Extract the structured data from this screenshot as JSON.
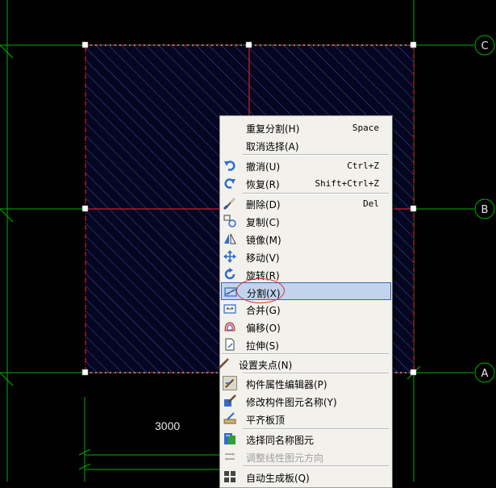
{
  "grid_labels": {
    "axis_a": "A",
    "axis_b": "B",
    "axis_c": "C"
  },
  "dimension_text": "3000",
  "menu": {
    "items": [
      {
        "label": "重复分割(H)",
        "shortcut": "Space",
        "icon": "none"
      },
      {
        "label": "取消选择(A)",
        "shortcut": "",
        "icon": "none"
      },
      {
        "label": "撤消(U)",
        "shortcut": "Ctrl+Z",
        "icon": "undo-icon"
      },
      {
        "label": "恢复(R)",
        "shortcut": "Shift+Ctrl+Z",
        "icon": "redo-icon"
      },
      {
        "label": "删除(D)",
        "shortcut": "Del",
        "icon": "delete-brush-icon"
      },
      {
        "label": "复制(C)",
        "shortcut": "",
        "icon": "copy-icon"
      },
      {
        "label": "镜像(M)",
        "shortcut": "",
        "icon": "mirror-icon"
      },
      {
        "label": "移动(V)",
        "shortcut": "",
        "icon": "move-icon"
      },
      {
        "label": "旋转(R)",
        "shortcut": "",
        "icon": "rotate-icon"
      },
      {
        "label": "分割(X)",
        "shortcut": "",
        "icon": "split-icon"
      },
      {
        "label": "合并(G)",
        "shortcut": "",
        "icon": "merge-icon"
      },
      {
        "label": "偏移(O)",
        "shortcut": "",
        "icon": "offset-icon"
      },
      {
        "label": "拉伸(S)",
        "shortcut": "",
        "icon": "stretch-icon"
      },
      {
        "label": "设置夹点(N)",
        "shortcut": "",
        "icon": "pencil-icon"
      },
      {
        "label": "构件属性编辑器(P)",
        "shortcut": "",
        "icon": "property-editor-icon"
      },
      {
        "label": "修改构件图元名称(Y)",
        "shortcut": "",
        "icon": "rename-icon"
      },
      {
        "label": "平齐板顶",
        "shortcut": "",
        "icon": "align-top-icon"
      },
      {
        "label": "选择同名称图元",
        "shortcut": "",
        "icon": "select-same-icon"
      },
      {
        "label": "调整线性图元方向",
        "shortcut": "",
        "icon": "direction-icon"
      },
      {
        "label": "自动生成板(Q)",
        "shortcut": "",
        "icon": "auto-slab-icon"
      }
    ]
  },
  "colors": {
    "highlight": "#c2d3ee",
    "grid_line": "#00c000",
    "selection": "#ff2020",
    "hatch": "#3a3a8c"
  }
}
